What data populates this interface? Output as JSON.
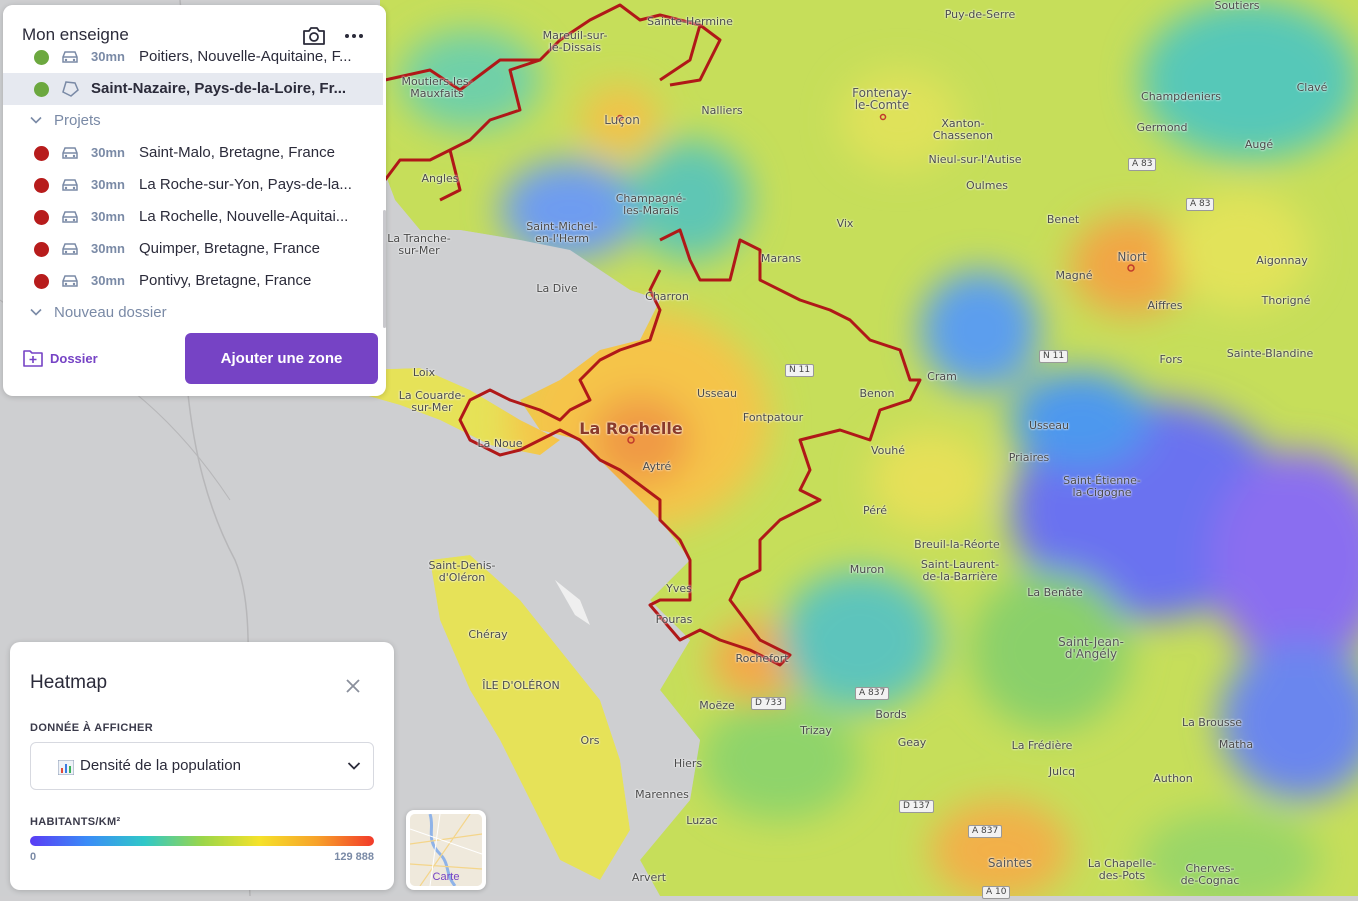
{
  "panel": {
    "title": "Mon enseigne",
    "rows_top": [
      {
        "duration": "30mn",
        "label": "Poitiers, Nouvelle-Aquitaine, F...",
        "status_color": "#6ca83f",
        "icon": "car-icon"
      },
      {
        "label": "Saint-Nazaire, Pays-de-la-Loire, Fr...",
        "status_color": "#6ca83f",
        "icon": "polygon-icon",
        "selected": true
      }
    ],
    "folders": [
      {
        "name": "Projets"
      },
      {
        "name": "Nouveau dossier"
      }
    ],
    "projects": [
      {
        "duration": "30mn",
        "label": "Saint-Malo, Bretagne, France"
      },
      {
        "duration": "30mn",
        "label": "La Roche-sur-Yon, Pays-de-la..."
      },
      {
        "duration": "30mn",
        "label": "La Rochelle, Nouvelle-Aquitai..."
      },
      {
        "duration": "30mn",
        "label": "Quimper, Bretagne, France"
      },
      {
        "duration": "30mn",
        "label": "Pontivy, Bretagne, France"
      }
    ],
    "dossier_button": "Dossier",
    "add_zone_button": "Ajouter une zone"
  },
  "heatmap": {
    "title": "Heatmap",
    "data_label": "DONNÉE À AFFICHER",
    "selected_data": "Densité de la population",
    "unit_label": "HABITANTS/KM²",
    "scale_min": "0",
    "scale_max": "129 888"
  },
  "basemap_switcher": {
    "label": "Carte"
  },
  "map": {
    "places": [
      {
        "name": "Puy-de-Serre"
      },
      {
        "name": "Soutiers"
      },
      {
        "name": "Mareuil-sur-\nle-Dissais"
      },
      {
        "name": "Sainte-Hermine"
      },
      {
        "name": "Moutiers-les-\nMauxfaits"
      },
      {
        "name": "Nalliers"
      },
      {
        "name": "Fontenay-\nle-Comte"
      },
      {
        "name": "Champdeniers"
      },
      {
        "name": "Clavé"
      },
      {
        "name": "Luçon"
      },
      {
        "name": "Xanton-\nChassenon"
      },
      {
        "name": "Germond"
      },
      {
        "name": "Nieul-sur-l'Autise"
      },
      {
        "name": "Augé"
      },
      {
        "name": "Angles"
      },
      {
        "name": "Oulmes"
      },
      {
        "name": "Champagné-\nles-Marais"
      },
      {
        "name": "Saint-Michel-\nen-l'Herm"
      },
      {
        "name": "Vix"
      },
      {
        "name": "Benet"
      },
      {
        "name": "La Tranche-\nsur-Mer"
      },
      {
        "name": "Magné"
      },
      {
        "name": "Niort"
      },
      {
        "name": "Aigonnay"
      },
      {
        "name": "Marans"
      },
      {
        "name": "La Dive"
      },
      {
        "name": "Charron"
      },
      {
        "name": "Aiffres"
      },
      {
        "name": "Thorigné"
      },
      {
        "name": "Fors"
      },
      {
        "name": "Sainte-Blandine"
      },
      {
        "name": "Loix"
      },
      {
        "name": "La Couarde-\nsur-Mer"
      },
      {
        "name": "Usseau"
      },
      {
        "name": "Cram"
      },
      {
        "name": "Benon"
      },
      {
        "name": "La Rochelle"
      },
      {
        "name": "Fontpatour"
      },
      {
        "name": "La Noue"
      },
      {
        "name": "Aytré"
      },
      {
        "name": "Vouhé"
      },
      {
        "name": "Usseau"
      },
      {
        "name": "Priaires"
      },
      {
        "name": "Saint-Étienne-\nla-Cigogne"
      },
      {
        "name": "Péré"
      },
      {
        "name": "Breuil-la-Réorte"
      },
      {
        "name": "Saint-Laurent-\nde-la-Barrière"
      },
      {
        "name": "Saint-Denis-\nd'Oléron"
      },
      {
        "name": "Yves"
      },
      {
        "name": "Muron"
      },
      {
        "name": "La Benâte"
      },
      {
        "name": "Fouras"
      },
      {
        "name": "Chéray"
      },
      {
        "name": "Saint-Jean-\nd'Angély"
      },
      {
        "name": "Rochefort"
      },
      {
        "name": "ÎLE D'OLÉRON"
      },
      {
        "name": "Moëze"
      },
      {
        "name": "Bords"
      },
      {
        "name": "Trizay"
      },
      {
        "name": "Geay"
      },
      {
        "name": "La Brousse"
      },
      {
        "name": "Matha"
      },
      {
        "name": "La Frédière"
      },
      {
        "name": "Hiers"
      },
      {
        "name": "Julcq"
      },
      {
        "name": "Authon"
      },
      {
        "name": "Marennes"
      },
      {
        "name": "Luzac"
      },
      {
        "name": "Saintes"
      },
      {
        "name": "La Chapelle-\ndes-Pots"
      },
      {
        "name": "Arvert"
      },
      {
        "name": "Cherves-\nde-Cognac"
      },
      {
        "name": "Ors"
      }
    ],
    "roads": [
      "A 83",
      "A 83",
      "N 11",
      "N 11",
      "A 837",
      "D 733",
      "D 137",
      "A 837",
      "A 10"
    ]
  }
}
